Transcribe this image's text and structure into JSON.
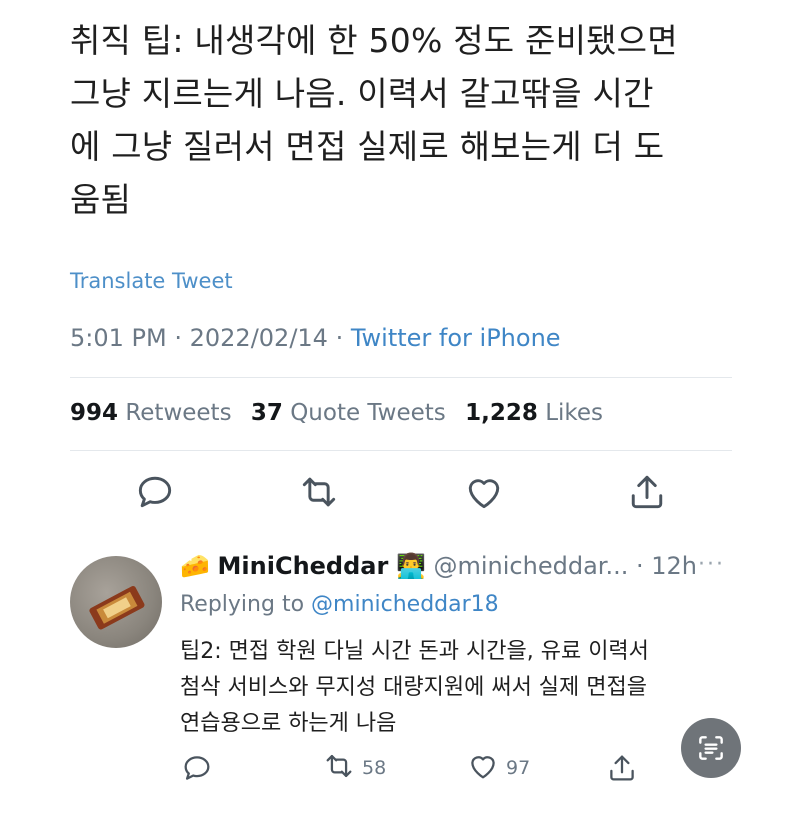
{
  "tweet": {
    "text_lines": [
      "취직 팁: 내생각에 한 50% 정도 준비됐으면",
      "그냥 지르는게 나음. 이력서 갈고딲을 시간",
      "에 그냥 질러서 면접 실제로 해보는게 더 도",
      "움됨"
    ],
    "translate_label": "Translate Tweet",
    "time": "5:01 PM",
    "date": "2022/02/14",
    "source": "Twitter for iPhone",
    "stats": {
      "retweets_count": "994",
      "retweets_label": "Retweets",
      "quotes_count": "37",
      "quotes_label": "Quote Tweets",
      "likes_count": "1,228",
      "likes_label": "Likes"
    },
    "actions": [
      "reply-icon",
      "retweet-icon",
      "like-icon",
      "share-icon"
    ]
  },
  "reply": {
    "name_emoji": "🧀",
    "display_name": "MiniCheddar",
    "name_badge": "👨‍💻",
    "handle": "@minicheddar...",
    "age": "· 12h",
    "more": "···",
    "replying_prefix": "Replying to",
    "replying_to": "@minicheddar18",
    "text_lines": [
      "팁2: 면접 학원 다닐 시간 돈과 시간을, 유료 이력서",
      "첨삭 서비스와 무지성 대량지원에 써서 실제 면접을",
      "연습용으로 하는게 나음"
    ],
    "retweets": "58",
    "likes": "97"
  },
  "colors": {
    "accent": "#3f86c6",
    "muted": "#6b7885",
    "fab": "#6f7479"
  }
}
